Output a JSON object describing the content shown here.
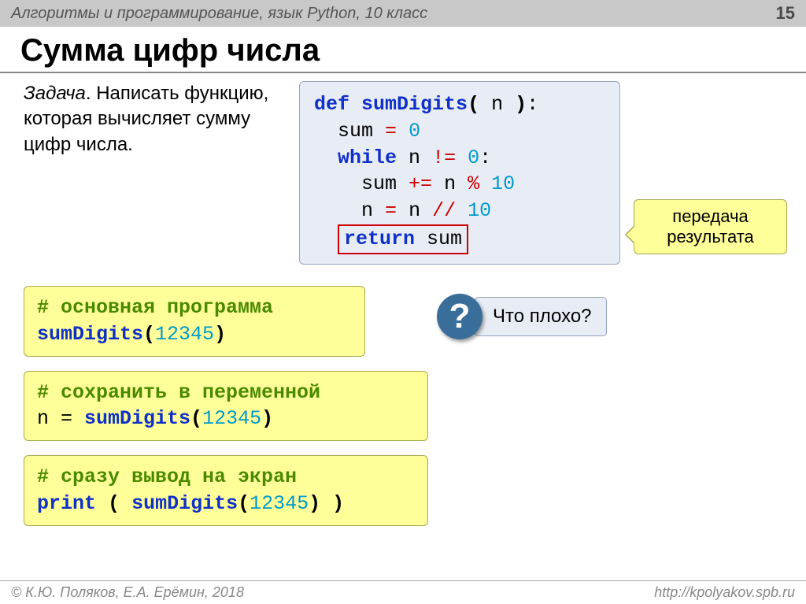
{
  "header": {
    "breadcrumb": "Алгоритмы и программирование, язык Python, 10 класс",
    "page": "15"
  },
  "title": "Сумма цифр числа",
  "task": {
    "label": "Задача",
    "body": ". Написать функцию, которая вычисляет сумму цифр числа."
  },
  "code": {
    "kw_def": "def",
    "fn": "sumDigits",
    "arg": "n",
    "l2a": "sum",
    "l2b": "0",
    "kw_while": "while",
    "l3a": "n",
    "l3b": "0",
    "l4a": "sum",
    "l4b": "n",
    "l4c": "10",
    "l5a": "n",
    "l5b": "n",
    "l5c": "10",
    "kw_return": "return",
    "l6": "sum"
  },
  "callout": {
    "line1": "передача",
    "line2": "результата"
  },
  "ex1": {
    "c": "# основная программа",
    "fn": "sumDigits",
    "arg": "12345"
  },
  "ex2": {
    "c": "# сохранить в переменной",
    "fn": "sumDigits",
    "arg": "12345"
  },
  "ex3": {
    "c": "# сразу вывод на экран",
    "print": "print",
    "fn": "sumDigits",
    "arg": "12345"
  },
  "question": {
    "icon": "?",
    "text": "Что плохо?"
  },
  "footer": {
    "left": "© К.Ю. Поляков, Е.А. Ерёмин, 2018",
    "right": "http://kpolyakov.spb.ru"
  }
}
